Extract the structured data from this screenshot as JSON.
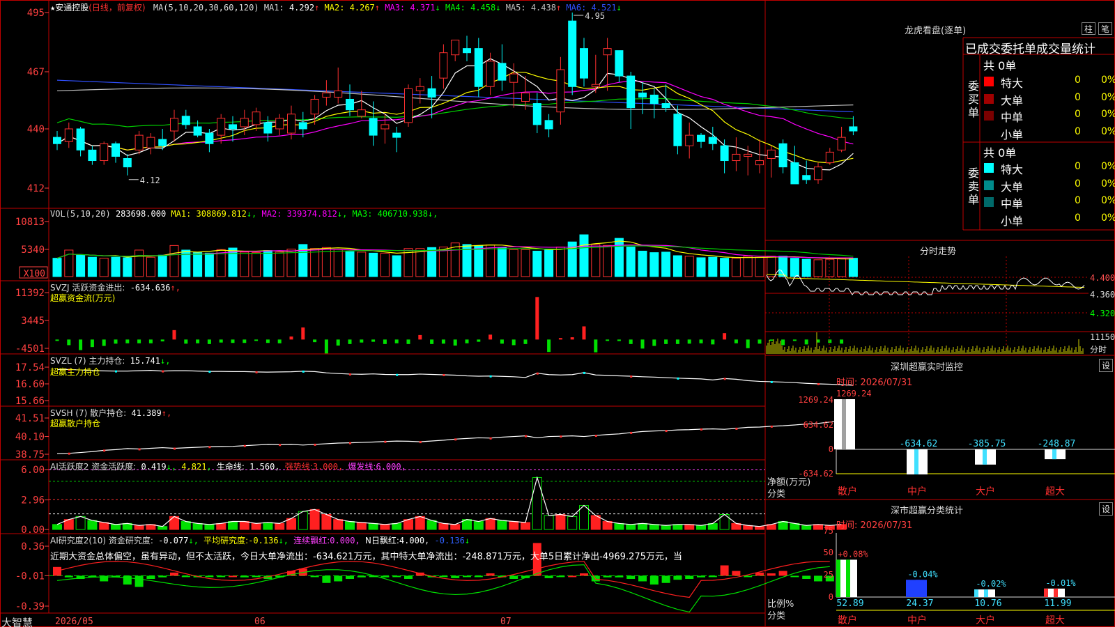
{
  "stock": {
    "star": "★",
    "name": "安通控股",
    "period": "(日线，前复权)",
    "ma_label": "MA(5,10,20,30,60,120)",
    "ma": [
      {
        "label": "MA1:",
        "value": "4.292",
        "arrow": "↑",
        "color": "#ffffff"
      },
      {
        "label": "MA2:",
        "value": "4.267",
        "arrow": "↑",
        "color": "#ffff00"
      },
      {
        "label": "MA3:",
        "value": "4.371",
        "arrow": "↓",
        "color": "#ff00ff"
      },
      {
        "label": "MA4:",
        "value": "4.458",
        "arrow": "↓",
        "color": "#00ff00"
      },
      {
        "label": "MA5:",
        "value": "4.438",
        "arrow": "↑",
        "color": "#c0c0c0"
      },
      {
        "label": "MA6:",
        "value": "4.521",
        "arrow": "↓",
        "color": "#3050ff"
      }
    ],
    "price_high_label": "4.95",
    "price_low_label": "4.12"
  },
  "panels": {
    "price_ticks": [
      "495",
      "467",
      "440",
      "412"
    ],
    "vol": {
      "header": "VOL(5,10,20)",
      "value": "283698.000",
      "ma": [
        {
          "label": "MA1:",
          "value": "308869.812",
          "arrow": "↓",
          "color": "#ffff00"
        },
        {
          "label": "MA2:",
          "value": "339374.812",
          "arrow": "↓",
          "color": "#ff00ff"
        },
        {
          "label": "MA3:",
          "value": "406710.938",
          "arrow": "↓",
          "color": "#00ff00"
        }
      ],
      "ticks": [
        "10813",
        "5340"
      ],
      "unit": "X100"
    },
    "svzj": {
      "header": "SVZJ  活跃资金进出:",
      "value": "-634.636",
      "arrow": "↑,",
      "subtitle": "超赢资金流(万元)",
      "ticks": [
        "11392",
        "3445",
        "-4501"
      ]
    },
    "svzl": {
      "header": "SVZL (7) 主力持仓:",
      "value": "15.741",
      "arrow": "↓,",
      "subtitle": "超赢主力持仓",
      "ticks": [
        "17.54",
        "16.60",
        "15.66"
      ]
    },
    "svsh": {
      "header": "SVSH (7) 散户持仓:",
      "value": "41.389",
      "arrow": "↑,",
      "subtitle": "超赢散户持仓",
      "ticks": [
        "41.51",
        "40.10",
        "38.75"
      ]
    },
    "ai1": {
      "header": "AI活跃度2 资金活跃度:",
      "v1": "0.419",
      "a1": "↓,",
      "v2": "4.821",
      "l2": "生命线:",
      "v3": "1.560",
      "l3": "强势线:",
      "v4": "3.000",
      "l4": "爆发线:",
      "v5": "6.000",
      "ticks": [
        "6.00",
        "2.96",
        "0.00"
      ]
    },
    "ai2": {
      "header": "AI研究度2(10) 资金研究度:",
      "v1": "-0.077",
      "l2": "平均研究度:",
      "v2": "-0.136",
      "l3": "连续飘红:",
      "v3": "0.000",
      "l4": "N日飘红:",
      "v4": "4.000",
      "v5": "-0.136",
      "comment": "近期大资金总体偏空，虽有异动，但不太活跃，今日大单净流出：-634.621万元，其中特大单净流出：-248.871万元，大单5日累计净出-4969.275万元，当",
      "ticks": [
        "0.36",
        "-0.01",
        "-0.39"
      ]
    }
  },
  "xaxis": {
    "labels": [
      "2026/05",
      "06",
      "07"
    ],
    "brand": "大智慧"
  },
  "right": {
    "lhb": {
      "title": "龙虎看盘(逐单)",
      "btn1": "柱",
      "btn2": "笔",
      "subtitle": "已成交委托单成交量统计",
      "buy_label": "委买单",
      "sell_label": "委卖单",
      "buy_total": "共 0单",
      "sell_total": "共 0单",
      "buy_rows": [
        {
          "name": "特大",
          "count": "0",
          "pct": "0%",
          "color": "#ff0000"
        },
        {
          "name": "大单",
          "count": "0",
          "pct": "0%",
          "color": "#a00000"
        },
        {
          "name": "中单",
          "count": "0",
          "pct": "0%",
          "color": "#7a0000"
        },
        {
          "name": "小单",
          "count": "0",
          "pct": "0%",
          "color": "#000000"
        }
      ],
      "sell_rows": [
        {
          "name": "特大",
          "count": "0",
          "pct": "0%",
          "color": "#00ffff"
        },
        {
          "name": "大单",
          "count": "0",
          "pct": "0%",
          "color": "#008c8c"
        },
        {
          "name": "中单",
          "count": "0",
          "pct": "0%",
          "color": "#006a6a"
        },
        {
          "name": "小单",
          "count": "0",
          "pct": "0%",
          "color": "#000000"
        }
      ]
    },
    "fenshi": {
      "title": "分时走势",
      "ticks": [
        "4.400",
        "4.360",
        "4.320"
      ],
      "vol_tick": "11150",
      "vol_unit": "分时"
    },
    "sz_monitor": {
      "title": "深圳超赢实时监控",
      "btn": "设",
      "time": "时间: 2026/07/31",
      "ticks": [
        "1269.24",
        "634.62",
        "0",
        "-634.62"
      ],
      "top_label": "1269.24",
      "values": [
        {
          "name": "散户",
          "value": 1269.24,
          "label": ""
        },
        {
          "name": "中户",
          "value": -634.62,
          "label": "-634.62"
        },
        {
          "name": "大户",
          "value": -385.75,
          "label": "-385.75"
        },
        {
          "name": "超大",
          "value": -248.87,
          "label": "-248.87"
        }
      ],
      "axis_label1": "净额(万元)",
      "axis_label2": "分类"
    },
    "sz_class": {
      "title": "深市超赢分类统计",
      "btn": "设",
      "time": "时间: 2026/07/31",
      "ticks": [
        "75",
        "50",
        "25",
        "0"
      ],
      "values": [
        {
          "name": "散户",
          "value": 52.89,
          "label": "52.89",
          "pct": "+0.08%"
        },
        {
          "name": "中户",
          "value": 24.37,
          "label": "24.37",
          "pct": "-0.04%"
        },
        {
          "name": "大户",
          "value": 10.76,
          "label": "10.76",
          "pct": "-0.02%"
        },
        {
          "name": "超大",
          "value": 11.99,
          "label": "11.99",
          "pct": "-0.01%"
        }
      ],
      "axis_label1": "比例%",
      "axis_label2": "分类"
    }
  },
  "chart_data": {
    "type": "candlestick",
    "y_range": [
      412,
      495
    ],
    "candles": [
      [
        436,
        439,
        430,
        433
      ],
      [
        434,
        443,
        431,
        440
      ],
      [
        440,
        441,
        427,
        430
      ],
      [
        430,
        432,
        423,
        425
      ],
      [
        425,
        434,
        423,
        433
      ],
      [
        433,
        434,
        424,
        427
      ],
      [
        426,
        428,
        418,
        422
      ],
      [
        430,
        439,
        428,
        437
      ],
      [
        431,
        438,
        428,
        436
      ],
      [
        435,
        440,
        430,
        432
      ],
      [
        439,
        449,
        434,
        445
      ],
      [
        446,
        449,
        440,
        442
      ],
      [
        441,
        444,
        436,
        437
      ],
      [
        438,
        440,
        429,
        433
      ],
      [
        437,
        447,
        433,
        445
      ],
      [
        442,
        446,
        434,
        440
      ],
      [
        441,
        449,
        437,
        445
      ],
      [
        442,
        450,
        439,
        448
      ],
      [
        443,
        446,
        434,
        438
      ],
      [
        440,
        447,
        437,
        445
      ],
      [
        438,
        451,
        435,
        447
      ],
      [
        443,
        448,
        436,
        440
      ],
      [
        447,
        456,
        442,
        454
      ],
      [
        455,
        463,
        451,
        457
      ],
      [
        455,
        469,
        452,
        458
      ],
      [
        454,
        461,
        446,
        449
      ],
      [
        446,
        458,
        445,
        449
      ],
      [
        445,
        453,
        432,
        437
      ],
      [
        440,
        447,
        433,
        442
      ],
      [
        438,
        441,
        429,
        436
      ],
      [
        443,
        461,
        441,
        459
      ],
      [
        458,
        464,
        452,
        460
      ],
      [
        459,
        465,
        445,
        455
      ],
      [
        464,
        480,
        459,
        476
      ],
      [
        475,
        482,
        472,
        482
      ],
      [
        478,
        484,
        472,
        476
      ],
      [
        478,
        483,
        455,
        460
      ],
      [
        460,
        476,
        456,
        472
      ],
      [
        471,
        480,
        458,
        463
      ],
      [
        462,
        471,
        450,
        466
      ],
      [
        453,
        465,
        449,
        457
      ],
      [
        452,
        457,
        438,
        442
      ],
      [
        444,
        447,
        436,
        440
      ],
      [
        448,
        474,
        442,
        468
      ],
      [
        491,
        495,
        456,
        460
      ],
      [
        478,
        483,
        460,
        464
      ],
      [
        460,
        475,
        457,
        461
      ],
      [
        475,
        483,
        458,
        478
      ],
      [
        477,
        477,
        462,
        465
      ],
      [
        465,
        467,
        440,
        450
      ],
      [
        457,
        462,
        447,
        455
      ],
      [
        456,
        459,
        445,
        452
      ],
      [
        452,
        461,
        448,
        450
      ],
      [
        447,
        451,
        428,
        432
      ],
      [
        432,
        443,
        426,
        437
      ],
      [
        437,
        438,
        431,
        434
      ],
      [
        436,
        441,
        430,
        433
      ],
      [
        432,
        435,
        419,
        425
      ],
      [
        425,
        436,
        420,
        428
      ],
      [
        427,
        432,
        418,
        428
      ],
      [
        423,
        435,
        419,
        425
      ],
      [
        426,
        432,
        417,
        430
      ],
      [
        433,
        435,
        419,
        422
      ],
      [
        424,
        432,
        414,
        414
      ],
      [
        418,
        425,
        414,
        416
      ],
      [
        416,
        424,
        414,
        422
      ],
      [
        424,
        431,
        423,
        429
      ],
      [
        430,
        441,
        429,
        436
      ],
      [
        441,
        446,
        437,
        439
      ]
    ],
    "volume": [
      36,
      52,
      42,
      38,
      36,
      38,
      37,
      52,
      38,
      42,
      61,
      52,
      47,
      46,
      53,
      56,
      48,
      47,
      51,
      48,
      54,
      63,
      55,
      57,
      53,
      49,
      48,
      46,
      46,
      41,
      55,
      55,
      57,
      58,
      66,
      63,
      61,
      62,
      57,
      53,
      53,
      50,
      52,
      58,
      68,
      82,
      63,
      61,
      75,
      58,
      50,
      47,
      48,
      41,
      40,
      37,
      38,
      36,
      36,
      40,
      38,
      40,
      40,
      36,
      34,
      33,
      34,
      36,
      36
    ],
    "svzj": [
      -0.3,
      -1.5,
      -2.8,
      -2.0,
      -1.7,
      -1.1,
      -1.0,
      -1.0,
      -1.0,
      -0.5,
      2.5,
      -1.1,
      -1.0,
      -1.2,
      -0.8,
      -0.9,
      -0.9,
      -0.3,
      -0.9,
      -1.0,
      0.8,
      3.2,
      -0.7,
      -3.7,
      -1.6,
      -1.2,
      -0.8,
      -0.6,
      -1.2,
      -1.0,
      -1.2,
      1.2,
      -1.2,
      -1.1,
      -1.6,
      -1.0,
      -0.6,
      1.3,
      -1.1,
      -1.5,
      -1.2,
      11.3,
      -3.3,
      0.4,
      0.6,
      3.5,
      -3.4,
      -0.3,
      -0.4,
      -1.2,
      -2.4,
      -1.7,
      -1.2,
      -1.2,
      -1.1,
      -1.0,
      -1.3,
      1.7,
      -1.0,
      -2.3,
      -1.1,
      -0.3,
      -1.5,
      -0.2,
      -1.3,
      -0.8,
      -0.9,
      -1.1
    ],
    "svzl": [
      17.4,
      17.41,
      17.38,
      17.35,
      17.33,
      17.32,
      17.32,
      17.34,
      17.36,
      17.32,
      17.34,
      17.34,
      17.32,
      17.3,
      17.3,
      17.29,
      17.29,
      17.27,
      17.26,
      17.27,
      17.28,
      17.31,
      17.29,
      17.22,
      17.18,
      17.15,
      17.14,
      17.16,
      17.13,
      17.12,
      17.12,
      17.15,
      17.13,
      17.11,
      17.09,
      17.05,
      17.03,
      17.04,
      17.02,
      17.0,
      16.96,
      17.2,
      17.12,
      17.1,
      17.12,
      17.23,
      17.1,
      17.08,
      17.05,
      17.03,
      17.0,
      16.98,
      16.95,
      16.92,
      16.9,
      16.88,
      16.82,
      16.9,
      16.86,
      16.78,
      16.74,
      16.72,
      16.7,
      16.67,
      16.63,
      16.6,
      16.58,
      16.55,
      15.74
    ],
    "svsh": [
      38.8,
      38.82,
      38.88,
      38.95,
      39.05,
      39.1,
      39.18,
      39.15,
      39.2,
      39.25,
      39.2,
      39.24,
      39.28,
      39.32,
      39.34,
      39.35,
      39.4,
      39.45,
      39.5,
      39.48,
      39.5,
      39.45,
      39.5,
      39.55,
      39.6,
      39.62,
      39.65,
      39.68,
      39.72,
      39.75,
      39.74,
      39.7,
      39.76,
      39.82,
      39.9,
      39.95,
      40.0,
      39.98,
      40.05,
      40.1,
      40.15,
      40.0,
      40.1,
      40.12,
      40.15,
      40.1,
      40.18,
      40.25,
      40.3,
      40.4,
      40.48,
      40.52,
      40.55,
      40.6,
      40.62,
      40.66,
      40.68,
      40.65,
      40.72,
      40.8,
      40.82,
      40.88,
      40.92,
      40.98,
      41.05,
      41.1,
      41.2,
      41.3,
      41.39
    ],
    "ai1": [
      0.5,
      1.0,
      1.3,
      0.9,
      0.7,
      0.5,
      0.6,
      0.4,
      0.5,
      0.3,
      1.3,
      0.8,
      0.6,
      0.5,
      0.6,
      0.8,
      0.8,
      0.6,
      0.7,
      0.6,
      1.1,
      1.8,
      2.0,
      1.5,
      1.0,
      0.8,
      0.7,
      0.6,
      0.5,
      0.6,
      1.0,
      1.3,
      0.9,
      0.6,
      0.5,
      1.0,
      0.8,
      1.1,
      0.9,
      0.8,
      0.7,
      5.2,
      1.4,
      1.5,
      1.3,
      2.4,
      1.4,
      0.8,
      0.6,
      0.5,
      0.6,
      0.5,
      0.4,
      0.5,
      0.5,
      0.4,
      0.6,
      1.5,
      0.6,
      0.4,
      0.3,
      0.5,
      0.8,
      0.6,
      0.4,
      0.5,
      0.4,
      0.5
    ],
    "ai2": [
      0.1,
      -0.03,
      -0.05,
      -0.03,
      -0.08,
      -0.03,
      -0.12,
      -0.15,
      -0.05,
      -0.03,
      0.03,
      -0.02,
      -0.03,
      -0.02,
      -0.02,
      -0.01,
      -0.03,
      -0.02,
      -0.05,
      -0.03,
      0.05,
      0.08,
      -0.02,
      -0.1,
      -0.08,
      -0.05,
      -0.03,
      -0.02,
      -0.03,
      -0.02,
      -0.05,
      0.03,
      -0.03,
      -0.02,
      -0.04,
      -0.02,
      -0.02,
      0.02,
      -0.03,
      -0.05,
      -0.04,
      0.4,
      -0.04,
      -0.02,
      -0.01,
      0.02,
      -0.08,
      -0.03,
      -0.03,
      -0.05,
      -0.08,
      -0.12,
      -0.1,
      -0.06,
      -0.05,
      -0.03,
      -0.02,
      0.12,
      0.05,
      -0.02,
      0.03,
      0.02,
      0.05,
      -0.02,
      -0.05,
      -0.08,
      -0.08
    ]
  }
}
